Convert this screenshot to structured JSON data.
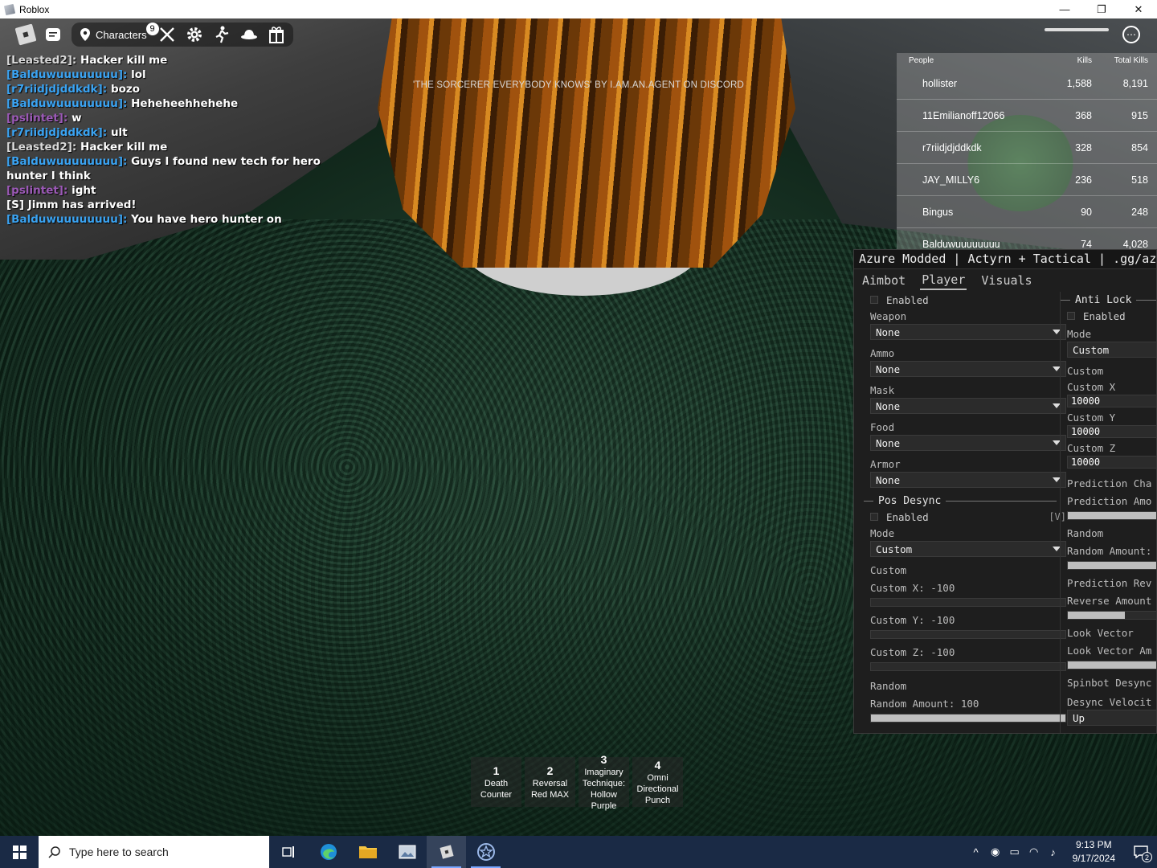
{
  "window": {
    "title": "Roblox",
    "minimize": "—",
    "maximize": "❐",
    "close": "✕"
  },
  "topbar": {
    "characters_label": "Characters",
    "characters_badge": "9"
  },
  "chat": [
    {
      "name": "[Leasted2]:",
      "msg": "Hacker kill me",
      "color": "#d9d9d9"
    },
    {
      "name": "[Balduwuuuuuuuu]:",
      "msg": "lol",
      "color": "#3aa3f2"
    },
    {
      "name": "[r7riidjdjddkdk]:",
      "msg": "bozo",
      "color": "#3aa3f2"
    },
    {
      "name": "[Balduwuuuuuuuu]:",
      "msg": "Heheheehhehehe",
      "color": "#3aa3f2"
    },
    {
      "name": "[pslintet]:",
      "msg": "w",
      "color": "#9b59b6"
    },
    {
      "name": "[r7riidjdjddkdk]:",
      "msg": "ult",
      "color": "#3aa3f2"
    },
    {
      "name": "[Leasted2]:",
      "msg": "Hacker kill me",
      "color": "#d9d9d9"
    },
    {
      "name": "[Balduwuuuuuuuu]:",
      "msg": "Guys I found new tech for hero hunter I think",
      "color": "#3aa3f2"
    },
    {
      "name": "[pslintet]:",
      "msg": "ight",
      "color": "#9b59b6"
    },
    {
      "name": "[S]",
      "msg": "Jimm has arrived!",
      "color": "#ffffff"
    },
    {
      "name": "[Balduwuuuuuuuu]:",
      "msg": "You have hero hunter on",
      "color": "#3aa3f2"
    }
  ],
  "banner": "'THE SORCERER EVERYBODY KNOWS' BY I.AM.AN.AGENT ON DISCORD",
  "leaderboard": {
    "headers": [
      "People",
      "Kills",
      "Total Kills"
    ],
    "rows": [
      {
        "name": "hollister",
        "kills": "1,588",
        "total": "8,191"
      },
      {
        "name": "11Emilianoff12066",
        "kills": "368",
        "total": "915"
      },
      {
        "name": "r7riidjdjddkdk",
        "kills": "328",
        "total": "854"
      },
      {
        "name": "JAY_MILLY6",
        "kills": "236",
        "total": "518"
      },
      {
        "name": "Bingus",
        "kills": "90",
        "total": "248"
      },
      {
        "name": "Balduwuuuuuuuu",
        "kills": "74",
        "total": "4,028"
      }
    ]
  },
  "azure": {
    "title": "Azure Modded | Actyrn + Tactical | .gg/azure",
    "tabs": [
      "Aimbot",
      "Player",
      "Visuals"
    ],
    "left": {
      "enabled": "Enabled",
      "weapon_label": "Weapon",
      "weapon_value": "None",
      "ammo_label": "Ammo",
      "ammo_value": "None",
      "mask_label": "Mask",
      "mask_value": "None",
      "food_label": "Food",
      "food_value": "None",
      "armor_label": "Armor",
      "armor_value": "None",
      "pos_desync": {
        "title": "Pos Desync",
        "enabled": "Enabled",
        "hotkey": "[V]",
        "mode_label": "Mode",
        "mode_value": "Custom",
        "custom_label": "Custom",
        "custom_x": "Custom X: -100",
        "custom_y": "Custom Y: -100",
        "custom_z": "Custom Z: -100",
        "random_label": "Random",
        "random_amount": "Random Amount: 100",
        "random_fill": 1.0
      }
    },
    "right": {
      "title": "Anti Lock",
      "enabled": "Enabled",
      "mode_label": "Mode",
      "mode_value": "Custom",
      "custom_label": "Custom",
      "custom_x_label": "Custom X",
      "custom_x_value": "10000",
      "custom_y_label": "Custom Y",
      "custom_y_value": "10000",
      "custom_z_label": "Custom Z",
      "custom_z_value": "10000",
      "prediction_cha": "Prediction Cha",
      "prediction_amo": "Prediction Amo",
      "random_label": "Random",
      "random_amount": "Random Amount:",
      "prediction_rev": "Prediction Rev",
      "reverse_amount": "Reverse Amount",
      "reverse_fill": 0.55,
      "look_vector": "Look Vector",
      "look_vector_am": "Look Vector Am",
      "spinbot": "Spinbot Desync",
      "desync_velocity": "Desync Velocit",
      "desync_value": "Up"
    }
  },
  "hotbar": [
    {
      "num": "1",
      "label": "Death Counter"
    },
    {
      "num": "2",
      "label": "Reversal Red MAX"
    },
    {
      "num": "3",
      "label": "Imaginary Technique: Hollow Purple"
    },
    {
      "num": "4",
      "label": "Omni Directional Punch"
    }
  ],
  "taskbar": {
    "search_placeholder": "Type here to search",
    "time": "9:13 PM",
    "date": "9/17/2024",
    "notif_count": "2"
  }
}
